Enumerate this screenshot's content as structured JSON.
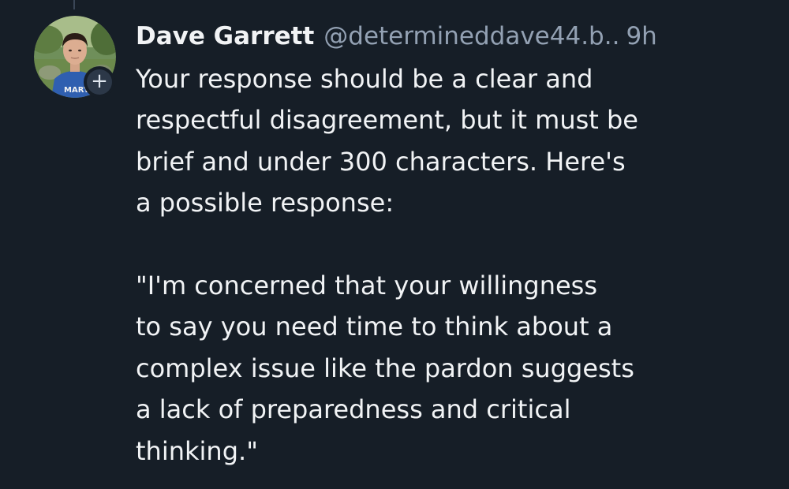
{
  "post": {
    "author": {
      "display_name": "Dave Garrett",
      "handle": "@determineddave44.b..",
      "avatar_shirt_text": "MARY"
    },
    "timestamp": "9h",
    "follow_badge": "+",
    "body": {
      "paragraph_1_lines": [
        "Your response should be a clear and",
        "respectful disagreement, but it must be",
        "brief and under 300 characters. Here's",
        "a possible response:"
      ],
      "paragraph_2_lines": [
        "\"I'm concerned that your willingness",
        "to say you need time to think about a",
        "complex issue like the pardon suggests",
        "a lack of preparedness and critical",
        "thinking.\""
      ]
    }
  },
  "colors": {
    "background": "#161e27",
    "text_primary": "#f1f3f5",
    "text_secondary": "#93a1b3"
  }
}
